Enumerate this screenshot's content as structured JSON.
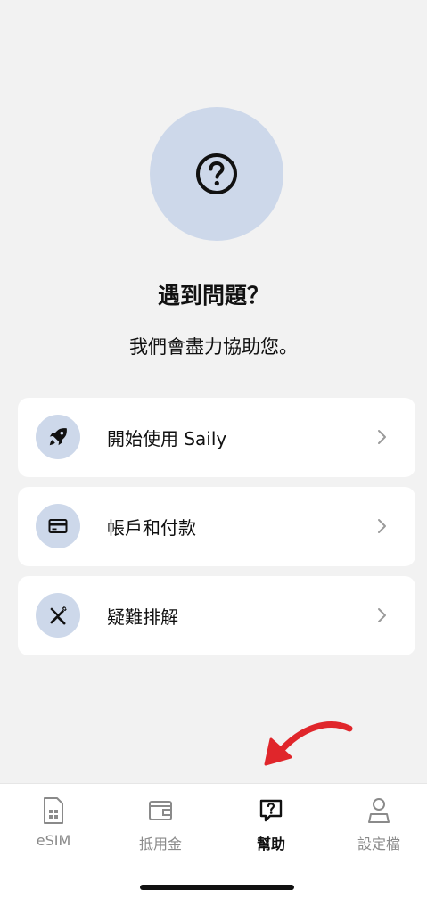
{
  "hero": {
    "icon": "question-circle-icon",
    "title": "遇到問題？",
    "subtitle": "我們會盡力協助您。"
  },
  "menu": [
    {
      "label": "開始使用 Saily",
      "icon": "rocket-icon"
    },
    {
      "label": "帳戶和付款",
      "icon": "credit-card-icon"
    },
    {
      "label": "疑難排解",
      "icon": "tools-icon"
    }
  ],
  "tabs": [
    {
      "label": "eSIM",
      "icon": "sim-card-icon",
      "active": false
    },
    {
      "label": "抵用金",
      "icon": "wallet-icon",
      "active": false
    },
    {
      "label": "幫助",
      "icon": "help-chat-icon",
      "active": true
    },
    {
      "label": "設定檔",
      "icon": "profile-icon",
      "active": false
    }
  ],
  "colors": {
    "background": "#f2f2f2",
    "accent_circle": "#cdd8ea",
    "annotation_arrow": "#e0262b",
    "inactive_tab": "#8a8a8a"
  }
}
